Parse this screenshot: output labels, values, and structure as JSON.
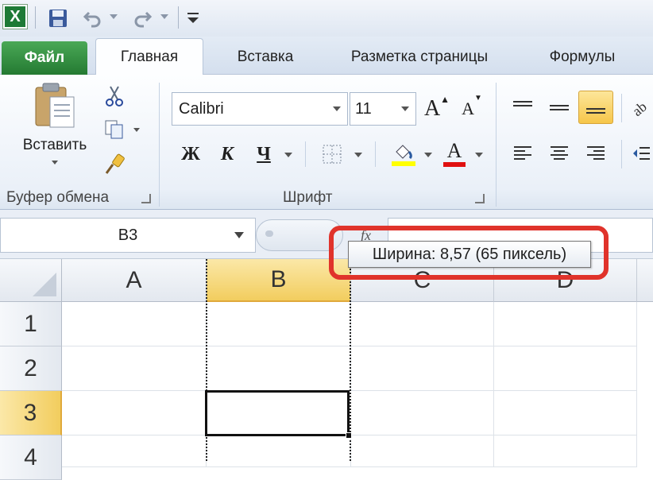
{
  "app": {
    "logo": "X"
  },
  "qat": {
    "save_icon": "save-icon",
    "undo_icon": "undo-icon",
    "redo_icon": "redo-icon"
  },
  "tabs": [
    {
      "label": "Файл"
    },
    {
      "label": "Главная"
    },
    {
      "label": "Вставка"
    },
    {
      "label": "Разметка страницы"
    },
    {
      "label": "Формулы"
    }
  ],
  "clipboard": {
    "paste_label": "Вставить",
    "group_label": "Буфер обмена"
  },
  "font": {
    "name": "Calibri",
    "size": "11",
    "bold": "Ж",
    "italic": "К",
    "underline": "Ч",
    "grow": "A",
    "shrink": "A",
    "font_color": "A",
    "group_label": "Шрифт"
  },
  "formula_bar": {
    "name_box": "B3"
  },
  "tooltip": {
    "text": "Ширина: 8,57 (65 пиксель)"
  },
  "grid": {
    "columns": [
      "A",
      "B",
      "C",
      "D"
    ],
    "rows": [
      "1",
      "2",
      "3",
      "4"
    ],
    "selected_column": "B",
    "selected_row": "3"
  },
  "colors": {
    "file_tab": "#2f8a3c",
    "highlight": "#f2d36b",
    "annotation": "#e0332b",
    "fill_yellow": "#ffff00",
    "font_red": "#e01010"
  }
}
